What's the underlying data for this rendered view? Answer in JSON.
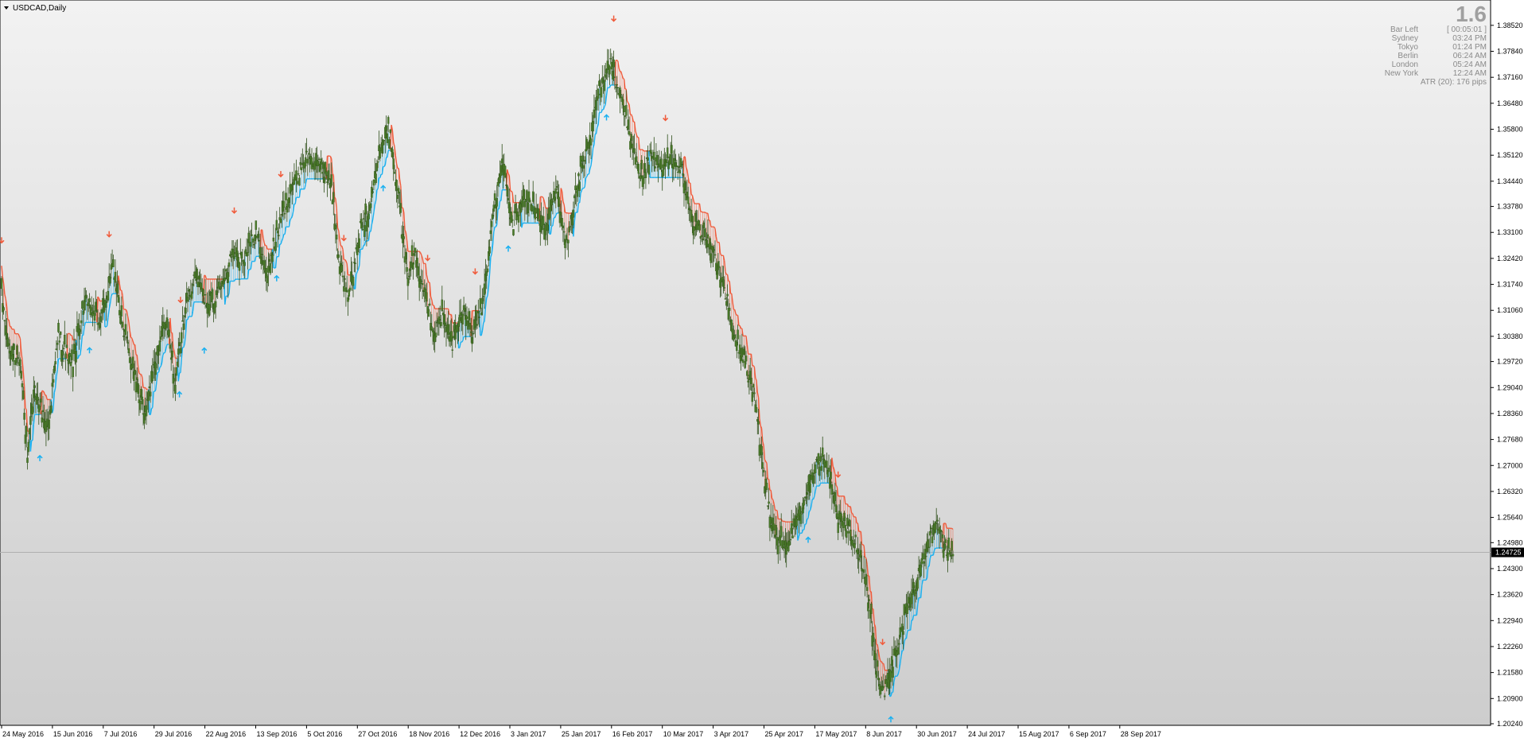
{
  "window": {
    "title": "USDCAD,Daily",
    "menu_icon": "triangle-down-icon"
  },
  "info_panel": {
    "spread": "1.6",
    "rows": [
      {
        "label": "Bar Left",
        "value": "[ 00:05:01 ]"
      },
      {
        "label": "Sydney",
        "value": "03:24 PM"
      },
      {
        "label": "Tokyo",
        "value": "01:24 PM"
      },
      {
        "label": "Berlin",
        "value": "06:24 AM"
      },
      {
        "label": "London",
        "value": "05:24 AM"
      },
      {
        "label": "New York",
        "value": "12:24 AM"
      }
    ],
    "atr": "ATR (20): 176 pips"
  },
  "colors": {
    "background_top": "#f2f2f2",
    "background_bottom": "#cdcdcd",
    "candle": "#4a7a2a",
    "candle_border": "#2f4f1a",
    "trend_up": "#1ab0f0",
    "trend_down": "#f05a3a",
    "bid_line": "#b0b0b0",
    "price_label_bg": "#000000"
  },
  "chart_data": {
    "type": "candlestick",
    "symbol": "USDCAD",
    "timeframe": "Daily",
    "current_price": "1.24725",
    "ylim": [
      1.2024,
      1.3885
    ],
    "y_ticks": [
      "1.38520",
      "1.37840",
      "1.37160",
      "1.36480",
      "1.35800",
      "1.35120",
      "1.34440",
      "1.33780",
      "1.33100",
      "1.32420",
      "1.31740",
      "1.31060",
      "1.30380",
      "1.29720",
      "1.29040",
      "1.28360",
      "1.27680",
      "1.27000",
      "1.26320",
      "1.25640",
      "1.24980",
      "1.24300",
      "1.23620",
      "1.22940",
      "1.22260",
      "1.21580",
      "1.20900",
      "1.20240"
    ],
    "x_ticks": [
      "24 May 2016",
      "15 Jun 2016",
      "7 Jul 2016",
      "29 Jul 2016",
      "22 Aug 2016",
      "13 Sep 2016",
      "5 Oct 2016",
      "27 Oct 2016",
      "18 Nov 2016",
      "12 Dec 2016",
      "3 Jan 2017",
      "25 Jan 2017",
      "16 Feb 2017",
      "10 Mar 2017",
      "3 Apr 2017",
      "25 Apr 2017",
      "17 May 2017",
      "8 Jun 2017",
      "30 Jun 2017",
      "24 Jul 2017",
      "15 Aug 2017",
      "6 Sep 2017",
      "28 Sep 2017"
    ],
    "path": [
      [
        0,
        1.3145
      ],
      [
        7,
        1.3
      ],
      [
        18,
        1.298
      ],
      [
        25,
        1.272
      ],
      [
        32,
        1.289
      ],
      [
        45,
        1.28
      ],
      [
        55,
        1.304
      ],
      [
        68,
        1.296
      ],
      [
        80,
        1.313
      ],
      [
        95,
        1.307
      ],
      [
        108,
        1.322
      ],
      [
        118,
        1.305
      ],
      [
        128,
        1.295
      ],
      [
        138,
        1.282
      ],
      [
        150,
        1.299
      ],
      [
        160,
        1.308
      ],
      [
        168,
        1.291
      ],
      [
        178,
        1.313
      ],
      [
        188,
        1.319
      ],
      [
        198,
        1.313
      ],
      [
        210,
        1.315
      ],
      [
        222,
        1.325
      ],
      [
        236,
        1.325
      ],
      [
        246,
        1.331
      ],
      [
        256,
        1.32
      ],
      [
        270,
        1.334
      ],
      [
        280,
        1.342
      ],
      [
        294,
        1.351
      ],
      [
        308,
        1.348
      ],
      [
        318,
        1.345
      ],
      [
        326,
        1.324
      ],
      [
        336,
        1.313
      ],
      [
        346,
        1.331
      ],
      [
        356,
        1.338
      ],
      [
        366,
        1.352
      ],
      [
        374,
        1.359
      ],
      [
        383,
        1.342
      ],
      [
        392,
        1.32
      ],
      [
        400,
        1.325
      ],
      [
        410,
        1.316
      ],
      [
        418,
        1.305
      ],
      [
        426,
        1.309
      ],
      [
        436,
        1.302
      ],
      [
        446,
        1.31
      ],
      [
        456,
        1.305
      ],
      [
        466,
        1.313
      ],
      [
        474,
        1.333
      ],
      [
        484,
        1.349
      ],
      [
        494,
        1.333
      ],
      [
        504,
        1.339
      ],
      [
        514,
        1.338
      ],
      [
        526,
        1.332
      ],
      [
        536,
        1.343
      ],
      [
        546,
        1.328
      ],
      [
        556,
        1.343
      ],
      [
        568,
        1.353
      ],
      [
        578,
        1.368
      ],
      [
        588,
        1.376
      ],
      [
        598,
        1.367
      ],
      [
        608,
        1.355
      ],
      [
        618,
        1.345
      ],
      [
        628,
        1.351
      ],
      [
        638,
        1.347
      ],
      [
        648,
        1.35
      ],
      [
        658,
        1.347
      ],
      [
        668,
        1.333
      ],
      [
        678,
        1.331
      ],
      [
        688,
        1.326
      ],
      [
        698,
        1.318
      ],
      [
        708,
        1.304
      ],
      [
        718,
        1.298
      ],
      [
        728,
        1.288
      ],
      [
        738,
        1.265
      ],
      [
        748,
        1.252
      ],
      [
        758,
        1.248
      ],
      [
        768,
        1.254
      ],
      [
        778,
        1.263
      ],
      [
        788,
        1.271
      ],
      [
        798,
        1.27
      ],
      [
        808,
        1.257
      ],
      [
        818,
        1.253
      ],
      [
        828,
        1.249
      ],
      [
        838,
        1.236
      ],
      [
        846,
        1.218
      ],
      [
        852,
        1.21
      ],
      [
        858,
        1.214
      ],
      [
        866,
        1.223
      ],
      [
        874,
        1.23
      ],
      [
        884,
        1.238
      ],
      [
        894,
        1.248
      ],
      [
        904,
        1.256
      ],
      [
        912,
        1.248
      ],
      [
        920,
        1.2472
      ]
    ],
    "arrows_down": [
      0,
      104,
      173,
      225,
      270,
      331,
      412,
      458,
      592,
      642,
      809,
      852
    ],
    "arrows_up": [
      37,
      85,
      172,
      196,
      266,
      369,
      490,
      585,
      780,
      860
    ]
  }
}
